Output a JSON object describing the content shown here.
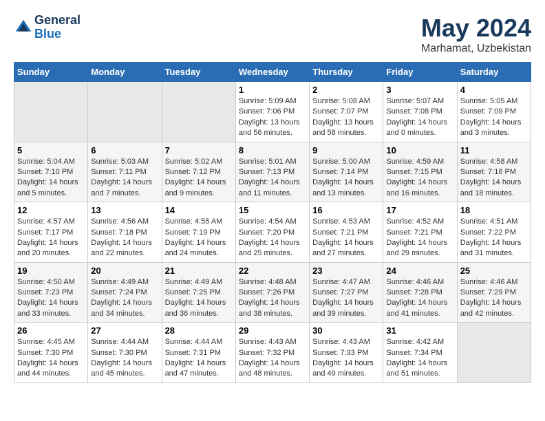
{
  "logo": {
    "name_line1": "General",
    "name_line2": "Blue"
  },
  "title": "May 2024",
  "location": "Marhamat, Uzbekistan",
  "days_of_week": [
    "Sunday",
    "Monday",
    "Tuesday",
    "Wednesday",
    "Thursday",
    "Friday",
    "Saturday"
  ],
  "weeks": [
    [
      {
        "day": "",
        "empty": true
      },
      {
        "day": "",
        "empty": true
      },
      {
        "day": "",
        "empty": true
      },
      {
        "day": "1",
        "sunrise": "5:09 AM",
        "sunset": "7:06 PM",
        "daylight": "13 hours and 56 minutes."
      },
      {
        "day": "2",
        "sunrise": "5:08 AM",
        "sunset": "7:07 PM",
        "daylight": "13 hours and 58 minutes."
      },
      {
        "day": "3",
        "sunrise": "5:07 AM",
        "sunset": "7:08 PM",
        "daylight": "14 hours and 0 minutes."
      },
      {
        "day": "4",
        "sunrise": "5:05 AM",
        "sunset": "7:09 PM",
        "daylight": "14 hours and 3 minutes."
      }
    ],
    [
      {
        "day": "5",
        "sunrise": "5:04 AM",
        "sunset": "7:10 PM",
        "daylight": "14 hours and 5 minutes."
      },
      {
        "day": "6",
        "sunrise": "5:03 AM",
        "sunset": "7:11 PM",
        "daylight": "14 hours and 7 minutes."
      },
      {
        "day": "7",
        "sunrise": "5:02 AM",
        "sunset": "7:12 PM",
        "daylight": "14 hours and 9 minutes."
      },
      {
        "day": "8",
        "sunrise": "5:01 AM",
        "sunset": "7:13 PM",
        "daylight": "14 hours and 11 minutes."
      },
      {
        "day": "9",
        "sunrise": "5:00 AM",
        "sunset": "7:14 PM",
        "daylight": "14 hours and 13 minutes."
      },
      {
        "day": "10",
        "sunrise": "4:59 AM",
        "sunset": "7:15 PM",
        "daylight": "14 hours and 16 minutes."
      },
      {
        "day": "11",
        "sunrise": "4:58 AM",
        "sunset": "7:16 PM",
        "daylight": "14 hours and 18 minutes."
      }
    ],
    [
      {
        "day": "12",
        "sunrise": "4:57 AM",
        "sunset": "7:17 PM",
        "daylight": "14 hours and 20 minutes."
      },
      {
        "day": "13",
        "sunrise": "4:56 AM",
        "sunset": "7:18 PM",
        "daylight": "14 hours and 22 minutes."
      },
      {
        "day": "14",
        "sunrise": "4:55 AM",
        "sunset": "7:19 PM",
        "daylight": "14 hours and 24 minutes."
      },
      {
        "day": "15",
        "sunrise": "4:54 AM",
        "sunset": "7:20 PM",
        "daylight": "14 hours and 25 minutes."
      },
      {
        "day": "16",
        "sunrise": "4:53 AM",
        "sunset": "7:21 PM",
        "daylight": "14 hours and 27 minutes."
      },
      {
        "day": "17",
        "sunrise": "4:52 AM",
        "sunset": "7:21 PM",
        "daylight": "14 hours and 29 minutes."
      },
      {
        "day": "18",
        "sunrise": "4:51 AM",
        "sunset": "7:22 PM",
        "daylight": "14 hours and 31 minutes."
      }
    ],
    [
      {
        "day": "19",
        "sunrise": "4:50 AM",
        "sunset": "7:23 PM",
        "daylight": "14 hours and 33 minutes."
      },
      {
        "day": "20",
        "sunrise": "4:49 AM",
        "sunset": "7:24 PM",
        "daylight": "14 hours and 34 minutes."
      },
      {
        "day": "21",
        "sunrise": "4:49 AM",
        "sunset": "7:25 PM",
        "daylight": "14 hours and 36 minutes."
      },
      {
        "day": "22",
        "sunrise": "4:48 AM",
        "sunset": "7:26 PM",
        "daylight": "14 hours and 38 minutes."
      },
      {
        "day": "23",
        "sunrise": "4:47 AM",
        "sunset": "7:27 PM",
        "daylight": "14 hours and 39 minutes."
      },
      {
        "day": "24",
        "sunrise": "4:46 AM",
        "sunset": "7:28 PM",
        "daylight": "14 hours and 41 minutes."
      },
      {
        "day": "25",
        "sunrise": "4:46 AM",
        "sunset": "7:29 PM",
        "daylight": "14 hours and 42 minutes."
      }
    ],
    [
      {
        "day": "26",
        "sunrise": "4:45 AM",
        "sunset": "7:30 PM",
        "daylight": "14 hours and 44 minutes."
      },
      {
        "day": "27",
        "sunrise": "4:44 AM",
        "sunset": "7:30 PM",
        "daylight": "14 hours and 45 minutes."
      },
      {
        "day": "28",
        "sunrise": "4:44 AM",
        "sunset": "7:31 PM",
        "daylight": "14 hours and 47 minutes."
      },
      {
        "day": "29",
        "sunrise": "4:43 AM",
        "sunset": "7:32 PM",
        "daylight": "14 hours and 48 minutes."
      },
      {
        "day": "30",
        "sunrise": "4:43 AM",
        "sunset": "7:33 PM",
        "daylight": "14 hours and 49 minutes."
      },
      {
        "day": "31",
        "sunrise": "4:42 AM",
        "sunset": "7:34 PM",
        "daylight": "14 hours and 51 minutes."
      },
      {
        "day": "",
        "empty": true
      }
    ]
  ],
  "labels": {
    "sunrise": "Sunrise:",
    "sunset": "Sunset:",
    "daylight": "Daylight:"
  }
}
